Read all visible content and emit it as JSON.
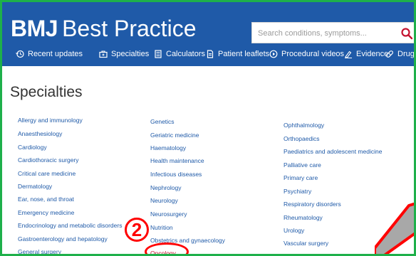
{
  "header": {
    "brand_bmj": "BMJ",
    "brand_name": "Best Practice",
    "search_placeholder": "Search conditions, symptoms..."
  },
  "nav": [
    {
      "label": "Recent updates",
      "icon": "history-icon"
    },
    {
      "label": "Specialties",
      "icon": "briefcase-icon"
    },
    {
      "label": "Calculators",
      "icon": "calculator-icon"
    },
    {
      "label": "Patient leaflets",
      "icon": "document-icon"
    },
    {
      "label": "Procedural videos",
      "icon": "play-icon"
    },
    {
      "label": "Evidence",
      "icon": "evidence-icon"
    },
    {
      "label": "Drugs",
      "icon": "pill-icon"
    }
  ],
  "page": {
    "title": "Specialties"
  },
  "columns": {
    "col1": [
      "Allergy and immunology",
      "Anaesthesiology",
      "Cardiology",
      "Cardiothoracic surgery",
      "Critical care medicine",
      "Dermatology",
      "Ear, nose, and throat",
      "Emergency medicine",
      "Endocrinology and metabolic disorders",
      "Gastroenterology and hepatology",
      "General surgery"
    ],
    "col2": [
      "Genetics",
      "Geriatric medicine",
      "Haematology",
      "Health maintenance",
      "Infectious diseases",
      "Nephrology",
      "Neurology",
      "Neurosurgery",
      "Nutrition",
      "Obstetrics and gynaecology",
      "Oncology"
    ],
    "col3": [
      "Ophthalmology",
      "Orthopaedics",
      "Paediatrics and adolescent medicine",
      "Palliative care",
      "Primary care",
      "Psychiatry",
      "Respiratory disorders",
      "Rheumatology",
      "Urology",
      "Vascular surgery"
    ]
  },
  "annotation": {
    "step_number": "2"
  },
  "colors": {
    "header_bg": "#1f5aa8",
    "border": "#1eb04a",
    "link": "#1f5aa8",
    "annotation": "#ff0000",
    "search_icon": "#c41230"
  }
}
